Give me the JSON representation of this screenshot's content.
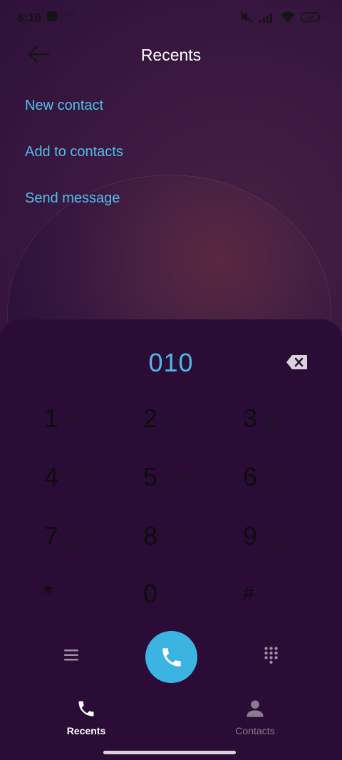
{
  "status_bar": {
    "time": "8:16",
    "more": "···",
    "battery": "100"
  },
  "header": {
    "title": "Recents"
  },
  "menu": [
    {
      "label": "New contact"
    },
    {
      "label": "Add to contacts"
    },
    {
      "label": "Send message"
    }
  ],
  "dialer": {
    "number": "010",
    "keys": [
      {
        "digit": "1",
        "zhuyin": "ㄍㄎㄏㄐ",
        "letters": ""
      },
      {
        "digit": "2",
        "zhuyin": "ㄅㄆㄇㄈ",
        "letters": "ABC"
      },
      {
        "digit": "3",
        "zhuyin": "ㄉㄊㄋㄌ",
        "letters": "DEF"
      },
      {
        "digit": "4",
        "zhuyin": "ㄑㄒㄓ",
        "letters": "GHI"
      },
      {
        "digit": "5",
        "zhuyin": "ㄔㄕㄖㄗ",
        "letters": "JKL"
      },
      {
        "digit": "6",
        "zhuyin": "ㄘㄙㄚ",
        "letters": "MNO"
      },
      {
        "digit": "7",
        "zhuyin": "ㄛㄜㄝㄞ",
        "letters": "PQRS"
      },
      {
        "digit": "8",
        "zhuyin": "ㄟㄠㄡㄢ",
        "letters": "TUV"
      },
      {
        "digit": "9",
        "zhuyin": "ㄣㄤㄥㄦㄧ",
        "letters": "WXYZ"
      },
      {
        "digit": "*",
        "zhuyin": "",
        "letters": "P"
      },
      {
        "digit": "0",
        "zhuyin": "˙ㄨㄩ",
        "letters": "+"
      },
      {
        "digit": "#",
        "zhuyin": "",
        "letters": ""
      }
    ]
  },
  "tabs": [
    {
      "label": "Recents",
      "active": true
    },
    {
      "label": "Contacts",
      "active": false
    }
  ],
  "colors": {
    "accent": "#4fc0ea",
    "call_button": "#3cb4e2",
    "background": "#2a0e38"
  }
}
